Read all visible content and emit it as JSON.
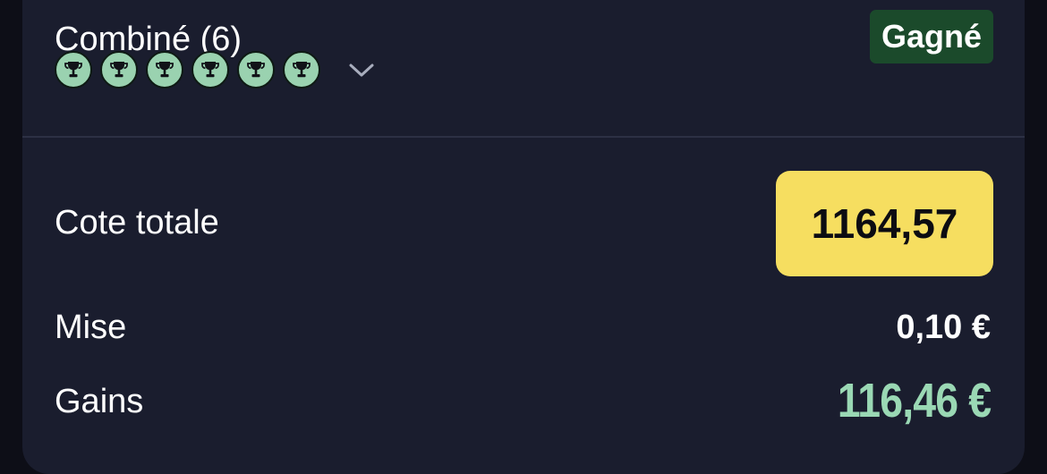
{
  "bet": {
    "title": "Combiné (6)",
    "status": "Gagné",
    "selections": [
      {
        "icon": "trophy-icon"
      },
      {
        "icon": "trophy-icon"
      },
      {
        "icon": "trophy-icon"
      },
      {
        "icon": "trophy-icon"
      },
      {
        "icon": "trophy-icon"
      },
      {
        "icon": "trophy-icon"
      }
    ],
    "expand_icon": "chevron-down-icon"
  },
  "summary": {
    "odds_label": "Cote totale",
    "odds_value": "1164,57",
    "stake_label": "Mise",
    "stake_value": "0,10 €",
    "winnings_label": "Gains",
    "winnings_value": "116,46 €"
  },
  "colors": {
    "card_bg": "#1a1d2e",
    "won_badge": "#1b4a2b",
    "odds_highlight": "#f6de60",
    "winnings_text": "#9ad8b4",
    "trophy_bg": "#9ad2b0"
  }
}
